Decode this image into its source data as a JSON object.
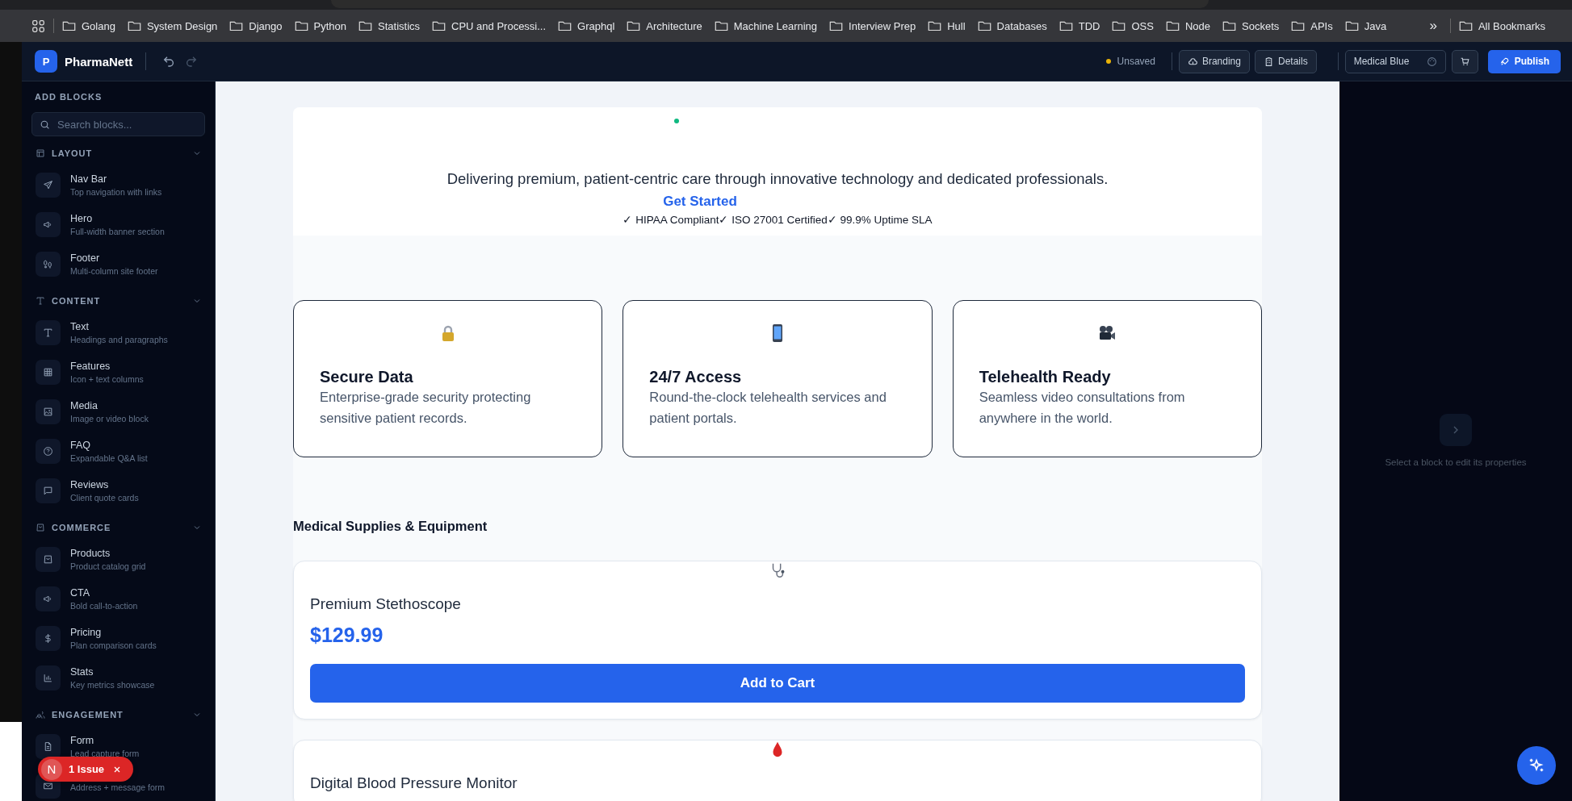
{
  "browser": {
    "bookmarks": [
      "Golang",
      "System Design",
      "Django",
      "Python",
      "Statistics",
      "CPU and Processi...",
      "Graphql",
      "Architecture",
      "Machine Learning",
      "Interview Prep",
      "Hull",
      "Databases",
      "TDD",
      "OSS",
      "Node",
      "Sockets",
      "APIs",
      "Java"
    ],
    "overflow": "»",
    "all_bookmarks": "All Bookmarks"
  },
  "app": {
    "logo_letter": "P",
    "name": "PharmaNett",
    "status": "Unsaved",
    "buttons": [
      {
        "kind": "cloud",
        "label": "Branding"
      },
      {
        "kind": "building",
        "label": "Details"
      }
    ],
    "theme": "Medical Blue",
    "publish": "Publish"
  },
  "sidebar": {
    "title": "ADD BLOCKS",
    "search": {
      "placeholder": "Search blocks..."
    },
    "sections": [
      {
        "label": "LAYOUT",
        "kind": "layout",
        "expanded": true,
        "items": [
          {
            "kind": "send",
            "title": "Nav Bar",
            "subtitle": "Top navigation with links"
          },
          {
            "kind": "megaphone",
            "title": "Hero",
            "subtitle": "Full-width banner section"
          },
          {
            "kind": "footprints",
            "title": "Footer",
            "subtitle": "Multi-column site footer"
          }
        ]
      },
      {
        "label": "CONTENT",
        "kind": "type",
        "expanded": true,
        "items": [
          {
            "kind": "type",
            "title": "Text",
            "subtitle": "Headings and paragraphs"
          },
          {
            "kind": "grid",
            "title": "Features",
            "subtitle": "Icon + text columns"
          },
          {
            "kind": "image",
            "title": "Media",
            "subtitle": "Image or video block"
          },
          {
            "kind": "help",
            "title": "FAQ",
            "subtitle": "Expandable Q&A list"
          },
          {
            "kind": "message",
            "title": "Reviews",
            "subtitle": "Client quote cards"
          }
        ]
      },
      {
        "label": "COMMERCE",
        "kind": "bag",
        "expanded": true,
        "items": [
          {
            "kind": "bag",
            "title": "Products",
            "subtitle": "Product catalog grid"
          },
          {
            "kind": "megaphone",
            "title": "CTA",
            "subtitle": "Bold call-to-action"
          },
          {
            "kind": "dollar",
            "title": "Pricing",
            "subtitle": "Plan comparison cards"
          },
          {
            "kind": "chart",
            "title": "Stats",
            "subtitle": "Key metrics showcase"
          }
        ]
      },
      {
        "label": "ENGAGEMENT",
        "kind": "users",
        "expanded": true,
        "items": [
          {
            "kind": "file",
            "title": "Form",
            "subtitle": "Lead capture form"
          },
          {
            "kind": "mail",
            "subtitle": "Address + message form"
          }
        ]
      }
    ]
  },
  "canvas": {
    "hero": {
      "tagline": "Delivering premium, patient-centric care through innovative technology and dedicated professionals.",
      "cta": "Get Started",
      "badges": "✓ HIPAA Compliant✓ ISO 27001 Certified✓ 99.9% Uptime SLA"
    },
    "features": [
      {
        "kind": "lock",
        "title": "Secure Data",
        "text": "Enterprise-grade security protecting sensitive patient records."
      },
      {
        "kind": "phone",
        "title": "24/7 Access",
        "text": "Round-the-clock telehealth services and patient portals."
      },
      {
        "kind": "camera",
        "title": "Telehealth Ready",
        "text": "Seamless video consultations from anywhere in the world."
      }
    ],
    "products": {
      "heading": "Medical Supplies & Equipment",
      "items": [
        {
          "kind": "stethoscope",
          "name": "Premium Stethoscope",
          "price": "$129.99",
          "button": "Add to Cart"
        },
        {
          "kind": "drop",
          "name": "Digital Blood Pressure Monitor"
        }
      ]
    }
  },
  "inspector": {
    "hint": "Select a block to edit its properties"
  },
  "issues_badge": {
    "letter": "N",
    "label": "1 Issue"
  }
}
